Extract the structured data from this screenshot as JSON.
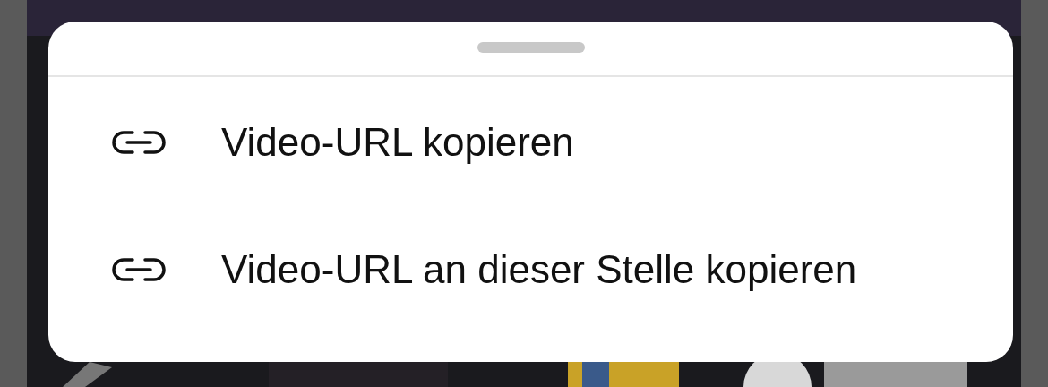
{
  "sheet": {
    "items": [
      {
        "label": "Video-URL kopieren"
      },
      {
        "label": "Video-URL an dieser Stelle kopieren"
      }
    ]
  }
}
